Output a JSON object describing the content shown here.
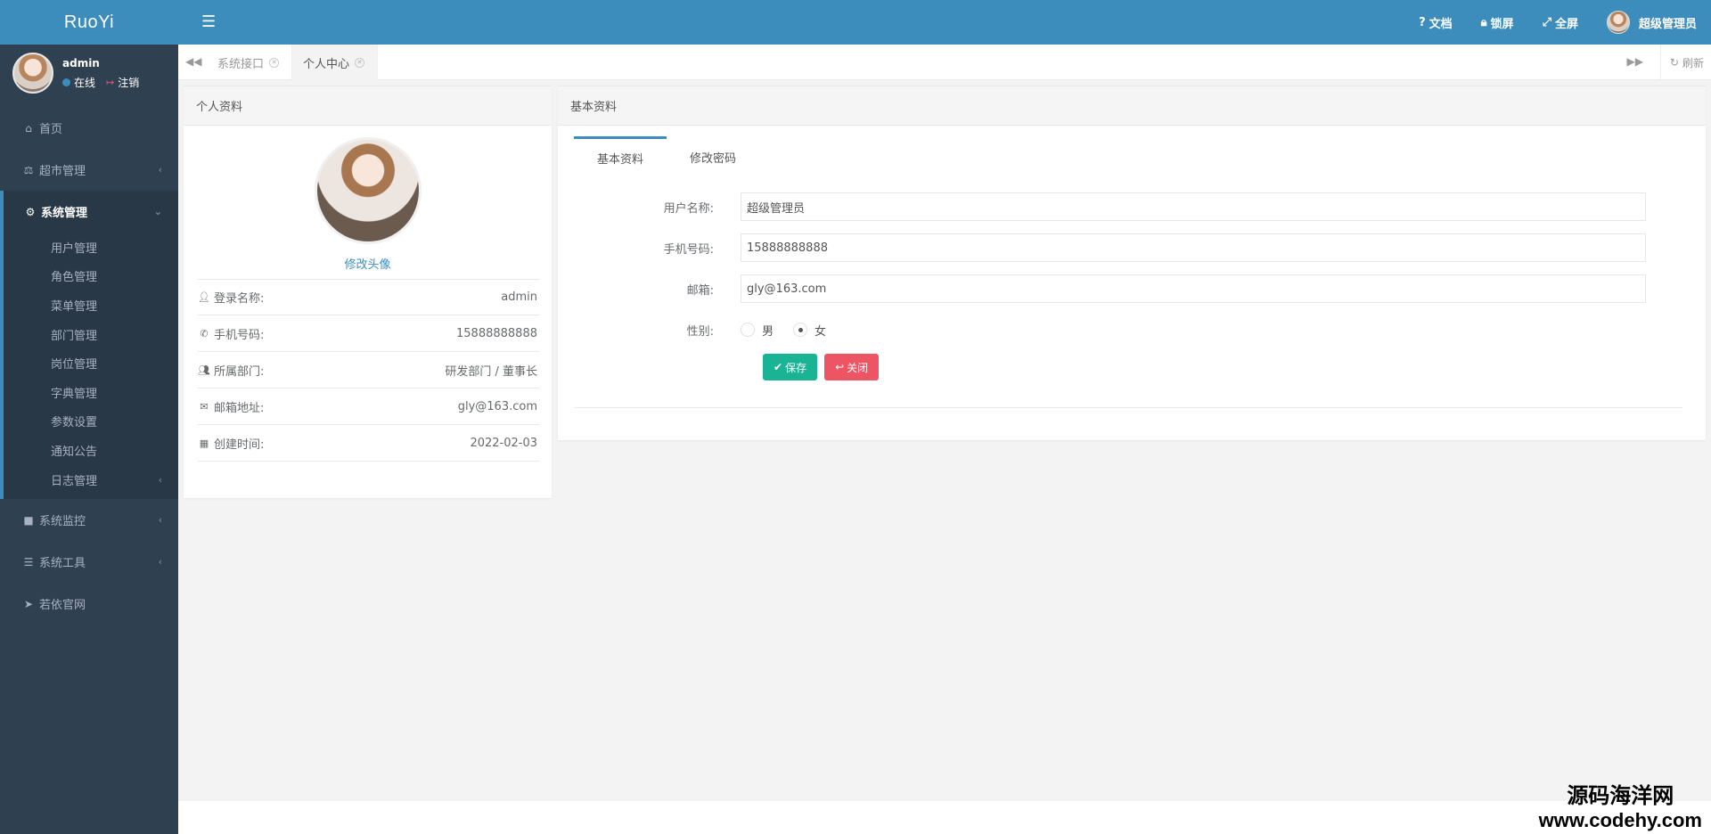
{
  "app": {
    "brand": "RuoYi"
  },
  "sidebar": {
    "user": {
      "name": "admin",
      "status": "在线",
      "logout": "注销"
    },
    "menu": [
      {
        "label": "首页",
        "icon": "home-icon"
      },
      {
        "label": "超市管理",
        "icon": "balance-icon",
        "arrow": "‹"
      },
      {
        "label": "系统管理",
        "icon": "gear-icon",
        "arrow": "⌄"
      }
    ],
    "submenu": [
      {
        "label": "用户管理"
      },
      {
        "label": "角色管理"
      },
      {
        "label": "菜单管理"
      },
      {
        "label": "部门管理"
      },
      {
        "label": "岗位管理"
      },
      {
        "label": "字典管理"
      },
      {
        "label": "参数设置"
      },
      {
        "label": "通知公告"
      },
      {
        "label": "日志管理",
        "arrow": "‹"
      }
    ],
    "menu_after": [
      {
        "label": "系统监控",
        "icon": "video-icon",
        "arrow": "‹"
      },
      {
        "label": "系统工具",
        "icon": "bars-icon",
        "arrow": "‹"
      },
      {
        "label": "若依官网",
        "icon": "send-icon"
      }
    ]
  },
  "topbar": {
    "docs": "文档",
    "lock": "锁屏",
    "fullscreen": "全屏",
    "username": "超级管理员"
  },
  "tabs": {
    "items": [
      {
        "label": "系统接口",
        "active": false
      },
      {
        "label": "个人中心",
        "active": true
      }
    ],
    "refresh": "刷新"
  },
  "profile": {
    "title": "个人资料",
    "change_avatar": "修改头像",
    "rows": [
      {
        "label": "登录名称:",
        "value": "admin",
        "icon": "user-icon"
      },
      {
        "label": "手机号码:",
        "value": "15888888888",
        "icon": "phone-icon"
      },
      {
        "label": "所属部门:",
        "value": "研发部门 / 董事长",
        "icon": "users-icon"
      },
      {
        "label": "邮箱地址:",
        "value": "gly@163.com",
        "icon": "envelope-icon"
      },
      {
        "label": "创建时间:",
        "value": "2022-02-03",
        "icon": "calendar-icon"
      }
    ]
  },
  "basic": {
    "title": "基本资料",
    "tabs": [
      "基本资料",
      "修改密码"
    ],
    "fields": {
      "username": {
        "label": "用户名称:",
        "value": "超级管理员"
      },
      "phone": {
        "label": "手机号码:",
        "value": "15888888888"
      },
      "email": {
        "label": "邮箱:",
        "value": "gly@163.com"
      },
      "gender": {
        "label": "性别:",
        "options": [
          "男",
          "女"
        ],
        "selected": "女"
      }
    },
    "save": "保存",
    "close": "关闭"
  },
  "watermark": {
    "cn": "源码海洋网",
    "url": "www.codehy.com"
  },
  "colors": {
    "primary": "#3c8dbc",
    "sidebar": "#2f4050",
    "save": "#1ab394",
    "close": "#ed5565"
  }
}
